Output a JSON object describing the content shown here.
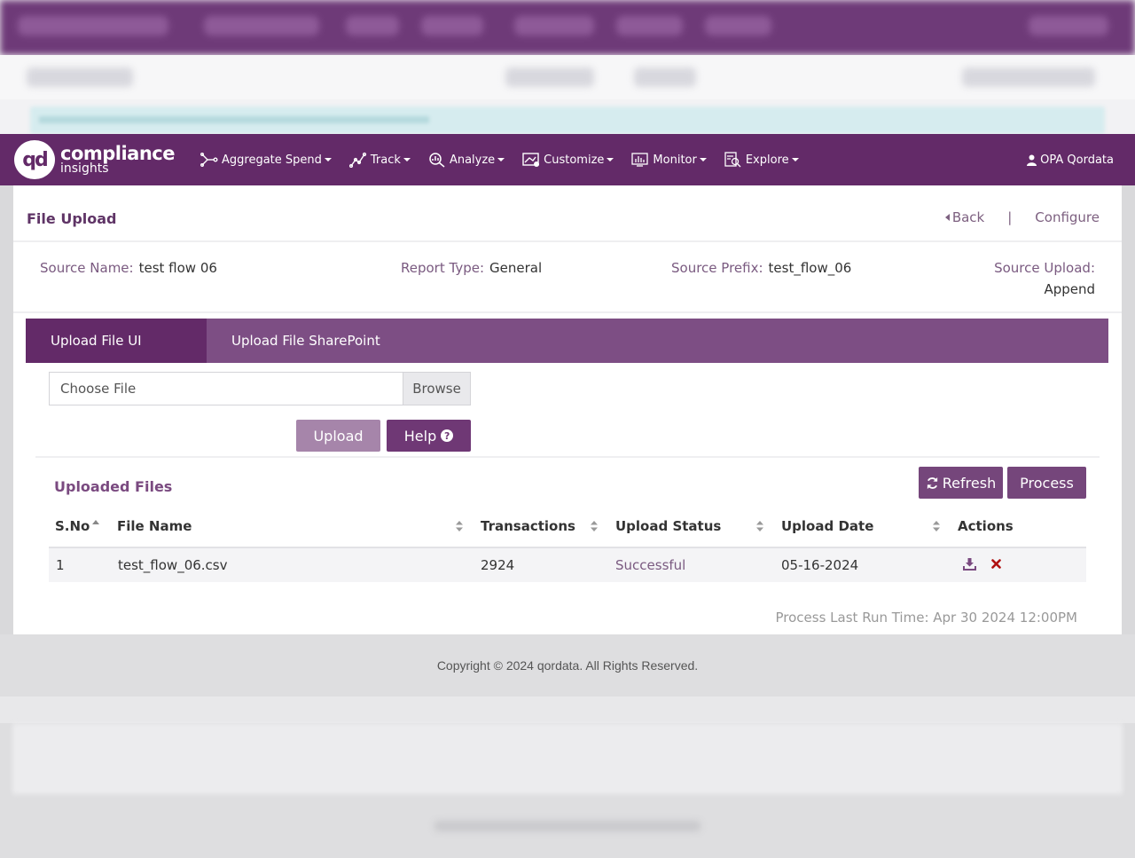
{
  "nav": {
    "logo_mark": "qd",
    "logo_line1": "compliance",
    "logo_line2": "insights",
    "items": [
      {
        "label": "Aggregate Spend",
        "icon": "aggregate-spend-icon"
      },
      {
        "label": "Track",
        "icon": "track-icon"
      },
      {
        "label": "Analyze",
        "icon": "analyze-icon"
      },
      {
        "label": "Customize",
        "icon": "customize-icon"
      },
      {
        "label": "Monitor",
        "icon": "monitor-icon"
      },
      {
        "label": "Explore",
        "icon": "explore-icon"
      }
    ],
    "user": "OPA Qordata"
  },
  "page": {
    "title": "File Upload",
    "back_label": "Back",
    "separator": "|",
    "configure_label": "Configure"
  },
  "info": {
    "source_name_label": "Source Name:",
    "source_name": "test flow 06",
    "report_type_label": "Report Type:",
    "report_type": "General",
    "source_prefix_label": "Source Prefix:",
    "source_prefix": "test_flow_06",
    "source_upload_label": "Source Upload:",
    "source_upload": "Append"
  },
  "tabs": [
    "Upload File UI",
    "Upload File SharePoint"
  ],
  "upload": {
    "choose_placeholder": "Choose File",
    "browse_label": "Browse",
    "upload_label": "Upload",
    "help_label": "Help",
    "help_glyph": "?"
  },
  "files": {
    "title": "Uploaded Files",
    "refresh_label": "Refresh",
    "process_label": "Process",
    "columns": [
      "S.No",
      "File Name",
      "Transactions",
      "Upload Status",
      "Upload Date",
      "Actions"
    ],
    "rows": [
      {
        "sno": "1",
        "file_name": "test_flow_06.csv",
        "transactions": "2924",
        "status": "Successful",
        "date": "05-16-2024"
      }
    ],
    "last_run": "Process Last Run Time: Apr 30 2024 12:00PM"
  },
  "footer": {
    "copyright": "Copyright © 2024 qordata. All Rights Reserved."
  },
  "colors": {
    "brand": "#632a68",
    "tab_bar": "#7d4e84",
    "button": "#75467b",
    "delete": "#b01010"
  }
}
